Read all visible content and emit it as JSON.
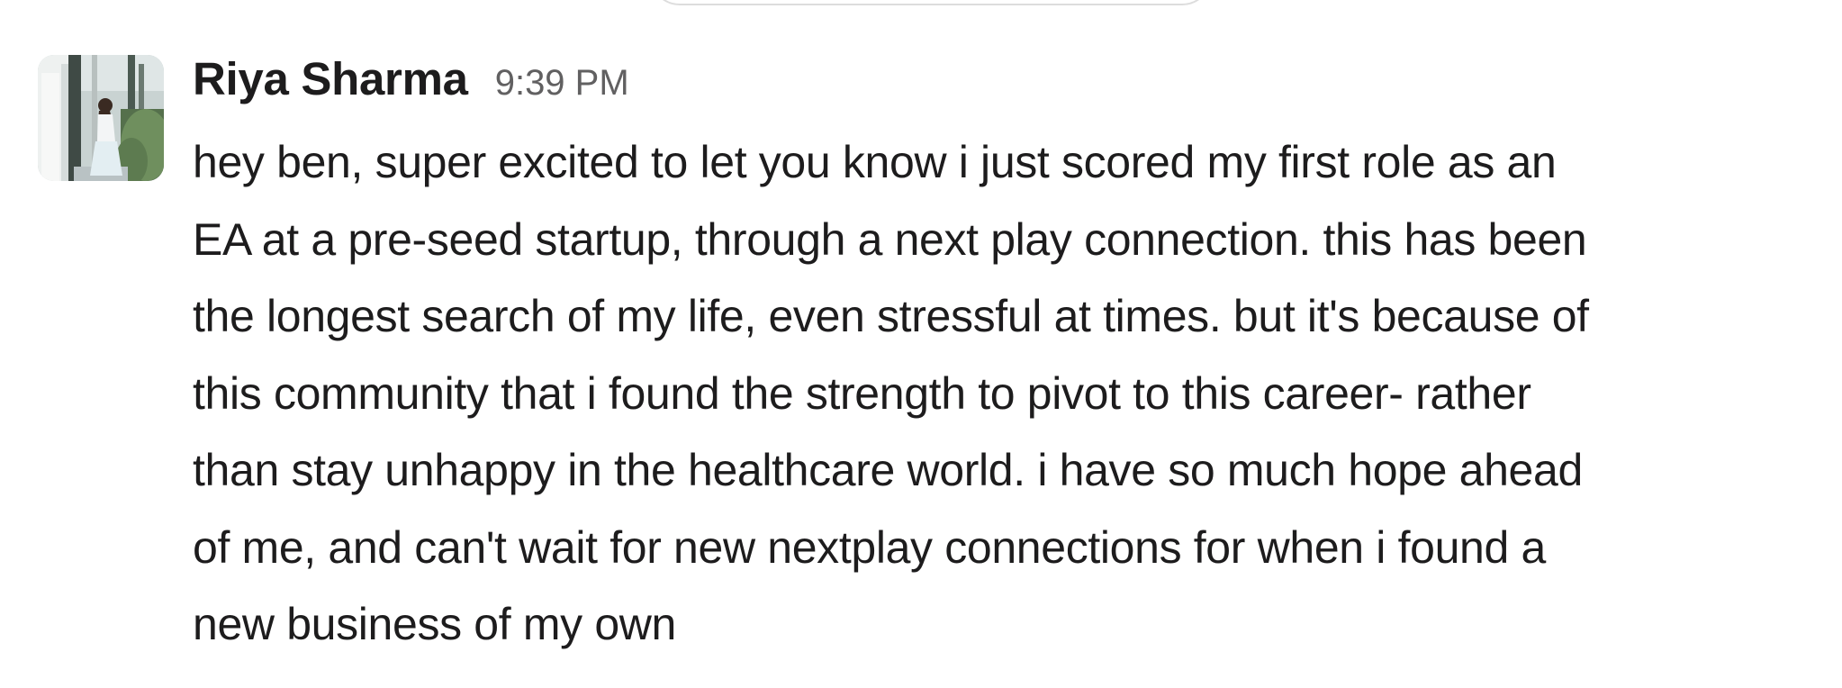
{
  "message": {
    "sender": "Riya Sharma",
    "timestamp": "9:39 PM",
    "avatar_icon": "user-avatar-photo",
    "lines": [
      "hey ben, super excited to let you know i just scored my first role as an",
      "EA at a pre-seed startup, through a next play connection. this has been",
      "the longest search of my life, even stressful at times. but it's because of",
      "this community that i found the strength to pivot to this career- rather",
      "than stay unhappy in the healthcare world. i have so much hope ahead",
      "of me, and can't wait for new nextplay connections for when i found a",
      "new business of my own"
    ]
  },
  "colors": {
    "text": "#1d1c1d",
    "timestamp": "#616061",
    "divider_border": "#dddddd",
    "background": "#ffffff"
  }
}
